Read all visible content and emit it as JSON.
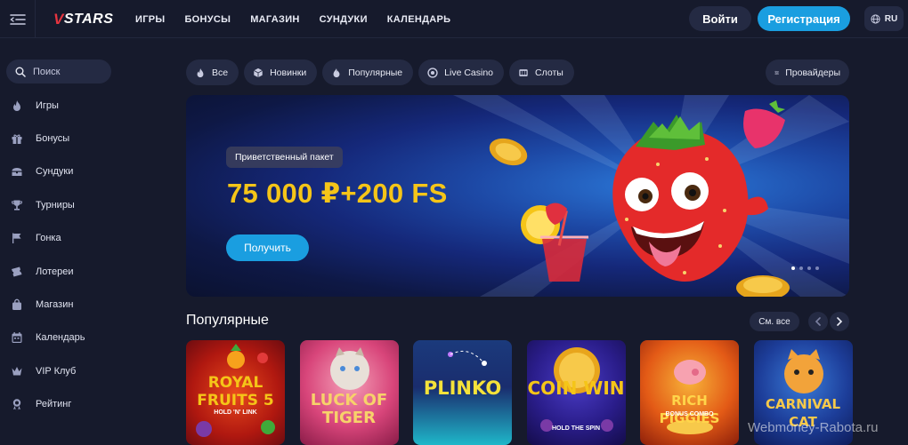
{
  "header": {
    "logo_text": "STARS",
    "logo_mark": "V",
    "nav": [
      "ИГРЫ",
      "БОНУСЫ",
      "МАГАЗИН",
      "СУНДУКИ",
      "КАЛЕНДАРЬ"
    ],
    "login_label": "Войти",
    "register_label": "Регистрация",
    "lang_label": "RU"
  },
  "sidebar": {
    "search_placeholder": "Поиск",
    "items": [
      {
        "label": "Игры",
        "icon": "flame-icon"
      },
      {
        "label": "Бонусы",
        "icon": "gift-icon"
      },
      {
        "label": "Сундуки",
        "icon": "chest-icon"
      },
      {
        "label": "Турниры",
        "icon": "trophy-icon"
      },
      {
        "label": "Гонка",
        "icon": "flag-icon"
      },
      {
        "label": "Лотереи",
        "icon": "ticket-icon"
      },
      {
        "label": "Магазин",
        "icon": "bag-icon"
      },
      {
        "label": "Календарь",
        "icon": "calendar-icon"
      },
      {
        "label": "VIP Клуб",
        "icon": "crown-icon"
      },
      {
        "label": "Рейтинг",
        "icon": "rating-icon"
      }
    ]
  },
  "filters": {
    "chips": [
      {
        "label": "Все",
        "icon": "flame-icon"
      },
      {
        "label": "Новинки",
        "icon": "cube-icon"
      },
      {
        "label": "Популярные",
        "icon": "fire-icon"
      },
      {
        "label": "Live Casino",
        "icon": "chip-icon"
      },
      {
        "label": "Слоты",
        "icon": "slots-icon"
      }
    ],
    "providers_label": "Провайдеры"
  },
  "banner": {
    "badge": "Приветственный пакет",
    "headline": "75 000 ₽+200 FS",
    "cta": "Получить",
    "slide_count": 4,
    "active_slide": 1
  },
  "popular": {
    "title": "Популярные",
    "see_all": "См. все",
    "games": [
      {
        "title": "ROYAL FRUITS 5",
        "subtitle": "HOLD 'N' LINK",
        "color": "#f5c518"
      },
      {
        "title": "LUCK OF TIGER",
        "subtitle": "",
        "color": "#f7d26a"
      },
      {
        "title": "PLINKO",
        "subtitle": "",
        "color": "#f5e23a"
      },
      {
        "title": "COIN WIN",
        "subtitle": "HOLD THE SPIN",
        "color": "#f5c518"
      },
      {
        "title": "RICH PIGGIES",
        "subtitle": "BONUS COMBO",
        "color": "#ffd54a"
      },
      {
        "title": "CARNIVAL CAT",
        "subtitle": "",
        "color": "#f7c94a"
      }
    ]
  },
  "watermark": "Webmoney-Rabota.ru",
  "colors": {
    "background": "#161a2c",
    "surface": "#242a43",
    "accent": "#1a9ee0",
    "promo": "#f5c518"
  }
}
